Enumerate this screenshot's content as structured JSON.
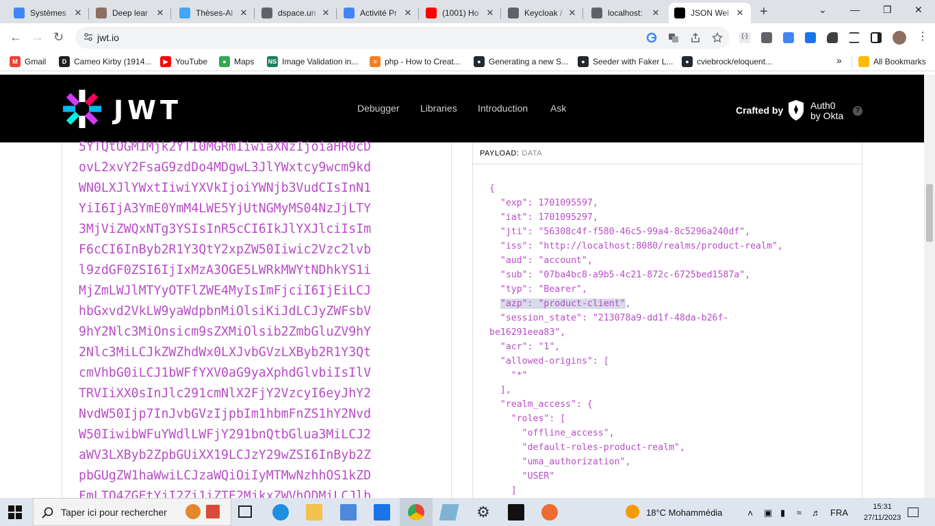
{
  "browser": {
    "tabs": [
      {
        "title": "Systèmes",
        "color": "#4285f4"
      },
      {
        "title": "Deep lear",
        "color": "#8d6e63"
      },
      {
        "title": "Thèses-Al",
        "color": "#42a5f5"
      },
      {
        "title": "dspace.un",
        "color": "#5f6368"
      },
      {
        "title": "Activité Pr",
        "color": "#4285f4"
      },
      {
        "title": "(1001) Ho",
        "color": "#ff0000"
      },
      {
        "title": "Keycloak /",
        "color": "#5f6368"
      },
      {
        "title": "localhost:",
        "color": "#5f6368"
      },
      {
        "title": "JSON Wel",
        "color": "#000000"
      }
    ],
    "url": "jwt.io",
    "bookmarks": [
      {
        "label": "Gmail",
        "icon": "M",
        "color": "#ea4335"
      },
      {
        "label": "Cameo Kirby (1914...",
        "icon": "D",
        "color": "#202124"
      },
      {
        "label": "YouTube",
        "icon": "▶",
        "color": "#ff0000"
      },
      {
        "label": "Maps",
        "icon": "●",
        "color": "#34a853"
      },
      {
        "label": "Image Validation in...",
        "icon": "NS",
        "color": "#1a7f5a"
      },
      {
        "label": "php - How to Creat...",
        "icon": "≡",
        "color": "#f48024"
      },
      {
        "label": "Generating a new S...",
        "icon": "●",
        "color": "#24292e"
      },
      {
        "label": "Seeder with Faker L...",
        "icon": "●",
        "color": "#24292e"
      },
      {
        "label": "cviebrock/eloquent...",
        "icon": "●",
        "color": "#24292e"
      }
    ],
    "all_bookmarks": "All Bookmarks",
    "more": "»"
  },
  "site": {
    "logo": "JWT",
    "nav": [
      "Debugger",
      "Libraries",
      "Introduction",
      "Ask"
    ],
    "crafted_by": "Crafted by",
    "auth0_line1": "Auth0",
    "auth0_line2": "by Okta",
    "help": "?"
  },
  "token_lines": [
    "5YTQtOGM1Mjk2YTI0MGRmIiwiaXNzIjoiaHR0cD",
    "ovL2xvY2FsaG9zdDo4MDgwL3JlYWxtcy9wcm9kd",
    "WN0LXJlYWxtIiwiYXVkIjoiYWNjb3VudCIsInN1",
    "YiI6IjA3YmE0YmM4LWE5YjUtNGMyMS04NzJjLTY",
    "3MjViZWQxNTg3YSIsInR5cCI6IkJlYXJlciIsIm",
    "F6cCI6InByb2R1Y3QtY2xpZW50Iiwic2Vzc2lvb",
    "l9zdGF0ZSI6IjIxMzA3OGE5LWRkMWYtNDhkYS1i",
    "MjZmLWJlMTYyOTFlZWE4MyIsImFjciI6IjEiLCJ",
    "hbGxvd2VkLW9yaWdpbnMiOlsiKiJdLCJyZWFsbV",
    "9hY2Nlc3MiOnsicm9sZXMiOlsib2ZmbGluZV9hY",
    "2Nlc3MiLCJkZWZhdWx0LXJvbGVzLXByb2R1Y3Qt",
    "cmVhbG0iLCJ1bWFfYXV0aG9yaXphdGlvbiIsIlV",
    "TRVIiXX0sInJlc291cmNlX2FjY2VzcyI6eyJhY2",
    "NvdW50Ijp7InJvbGVzIjpbIm1hbmFnZS1hY2Nvd",
    "W50IiwibWFuYWdlLWFjY291bnQtbGlua3MiLCJ2",
    "aWV3LXByb2ZpbGUiXX19LCJzY29wZSI6InByb2Z",
    "pbGUgZW1haWwiLCJzaWQiOiIyMTMwNzhhOS1kZD",
    "FmLTQ4ZGEtYjI2Zi1iZTE2MjkxZWVhODMiLCJlb"
  ],
  "payload": {
    "label": "PAYLOAD:",
    "sublabel": "DATA",
    "lines": [
      "{",
      "  \"exp\": 1701095597,",
      "  \"iat\": 1701095297,",
      "  \"jti\": \"56308c4f-f580-46c5-99a4-8c5296a240df\",",
      "  \"iss\": \"http://localhost:8080/realms/product-realm\",",
      "  \"aud\": \"account\",",
      "  \"sub\": \"07ba4bc8-a9b5-4c21-872c-6725bed1587a\",",
      "  \"typ\": \"Bearer\",",
      "  \"azp\": \"product-client\",",
      "  \"session_state\": \"213078a9-dd1f-48da-b26f-",
      "be16291eea83\",",
      "  \"acr\": \"1\",",
      "  \"allowed-origins\": [",
      "    \"*\"",
      "  ],",
      "  \"realm_access\": {",
      "    \"roles\": [",
      "      \"offline_access\",",
      "      \"default-roles-product-realm\",",
      "      \"uma_authorization\",",
      "      \"USER\"",
      "    ]"
    ]
  },
  "taskbar": {
    "search_placeholder": "Taper ici pour rechercher",
    "weather": "18°C  Mohammédia",
    "lang": "FRA",
    "time": "15:31",
    "date": "27/11/2023"
  }
}
